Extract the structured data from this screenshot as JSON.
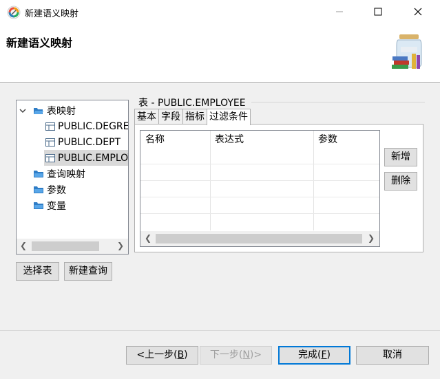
{
  "window": {
    "title": "新建语义映射",
    "minimize_icon": "minimize-icon",
    "maximize_icon": "maximize-icon",
    "close_icon": "close-icon"
  },
  "header": {
    "title": "新建语义映射",
    "art": "jar-with-books-icon"
  },
  "tree": {
    "items": [
      {
        "label": "表映射",
        "icon": "folder-open-icon",
        "expanded": true
      },
      {
        "label": "PUBLIC.DEGREE",
        "icon": "table-icon"
      },
      {
        "label": "PUBLIC.DEPT",
        "icon": "table-icon"
      },
      {
        "label": "PUBLIC.EMPLOYEE",
        "icon": "table-icon",
        "selected": true
      },
      {
        "label": "查询映射",
        "icon": "folder-icon"
      },
      {
        "label": "参数",
        "icon": "folder-icon"
      },
      {
        "label": "变量",
        "icon": "folder-icon"
      }
    ]
  },
  "panel": {
    "title": "表 - PUBLIC.EMPLOYEE",
    "tabs": [
      "基本",
      "字段",
      "指标",
      "过滤条件"
    ],
    "active_tab": "过滤条件",
    "columns": [
      "名称",
      "表达式",
      "参数"
    ]
  },
  "side_buttons": {
    "add": "新增",
    "delete": "删除"
  },
  "left_buttons": {
    "select_table": "选择表",
    "new_query": "新建查询"
  },
  "footer": {
    "back": "<上一步(",
    "back_key": "B",
    "back_end": ")",
    "next": "下一步(",
    "next_key": "N",
    "next_end": ")>",
    "finish": "完成(",
    "finish_key": "F",
    "finish_end": ")",
    "cancel": "取消"
  }
}
